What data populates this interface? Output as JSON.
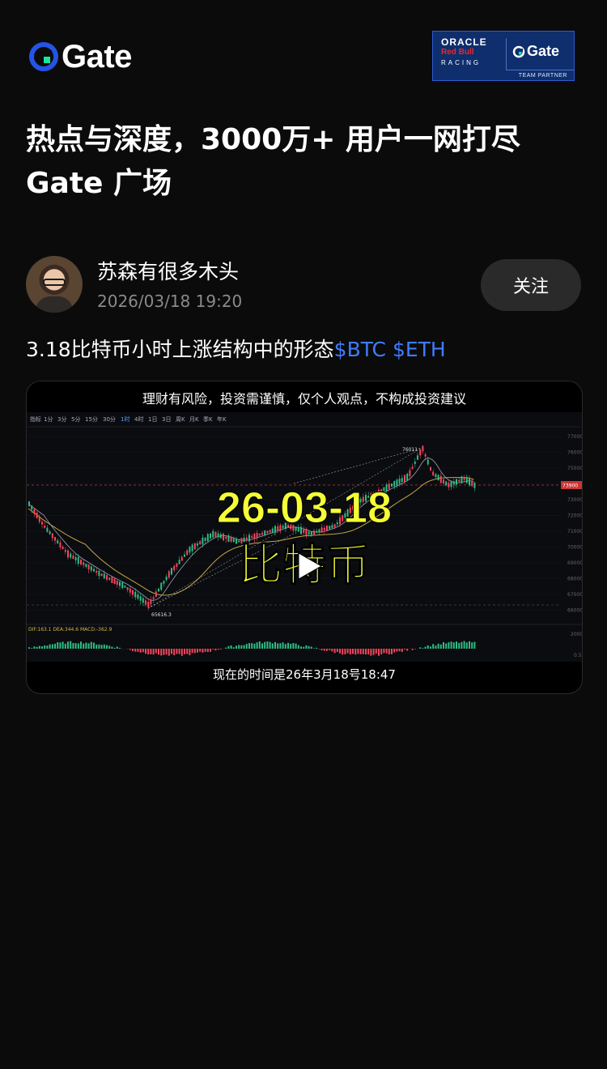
{
  "brand": {
    "logo_text": "Gate",
    "partner": {
      "oracle": "ORACLE",
      "redbull": "Red Bull",
      "racing": "RACING",
      "gate": "Gate",
      "team": "TEAM PARTNER"
    }
  },
  "headline": {
    "line1": "热点与深度，3000万+ 用户一网打尽",
    "line2": "Gate 广场"
  },
  "author": {
    "name": "苏森有很多木头",
    "time": "2026/03/18 19:20",
    "follow_label": "关注"
  },
  "post": {
    "text": "3.18比特币小时上涨结构中的形态",
    "tags": [
      "$BTC",
      "$ETH"
    ]
  },
  "video": {
    "warning": "理财有风险，投资需谨慎，仅个人观点，不构成投资建议",
    "overlay_date": "26-03-18",
    "overlay_coin": "比特币",
    "caption": "现在的时间是26年3月18号18:47",
    "chart": {
      "toolbar": [
        "指标",
        "1分",
        "3分",
        "5分",
        "15分",
        "30分",
        "1时",
        "4时",
        "1日",
        "3日",
        "周K",
        "月K",
        "季K",
        "年K"
      ],
      "price_labels": [
        "77000",
        "76000",
        "75000",
        "74000",
        "73000",
        "72000",
        "71000",
        "70000",
        "69000",
        "68000",
        "67000",
        "66000"
      ],
      "high_label": "76011",
      "low_label": "65616.3",
      "current_price": "73900",
      "macd_text": "DIF:163.1  DEA:344.6  MACD:-362.9",
      "macd_axis": [
        "2000",
        "0.5"
      ]
    }
  },
  "colors": {
    "accent": "#3f7cff",
    "overlay": "#f4ff35",
    "up": "#2ebd85",
    "down": "#f6465d"
  }
}
